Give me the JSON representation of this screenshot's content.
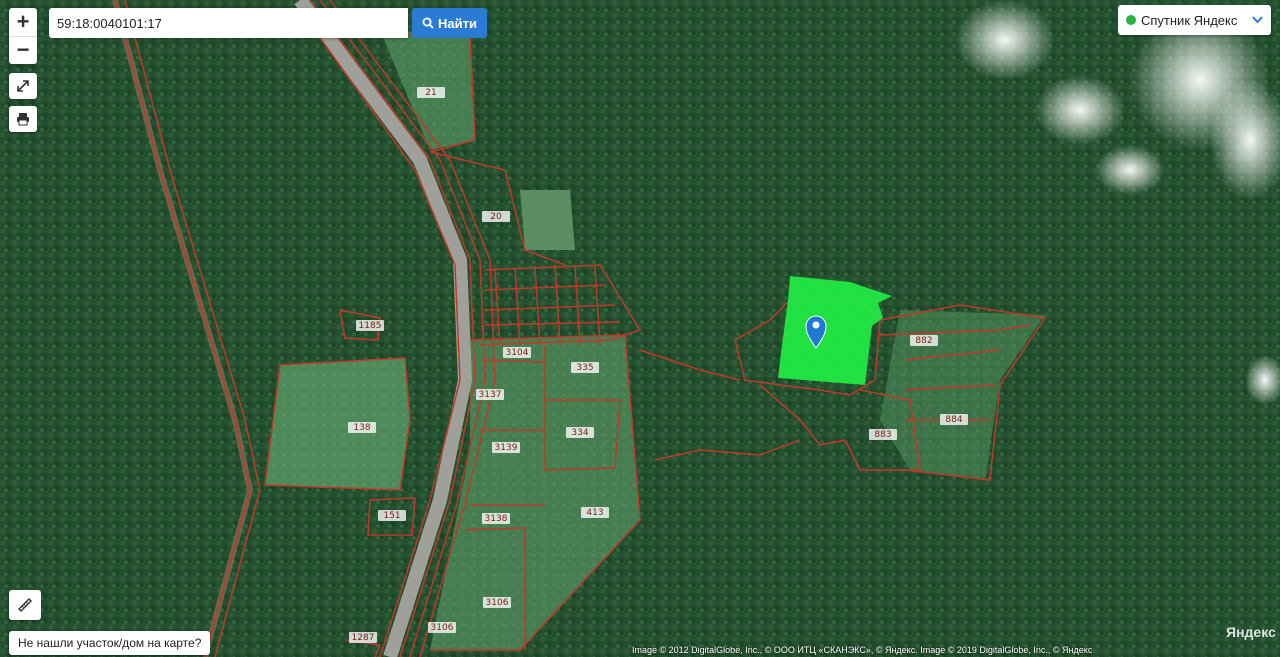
{
  "search": {
    "value": "59:18:0040101:17",
    "button_label": "Найти"
  },
  "zoom": {
    "in_label": "+",
    "out_label": "−"
  },
  "layer": {
    "label": "Спутник Яндекс",
    "active_color": "#2bb140"
  },
  "not_found_label": "Не нашли участок/дом на карте?",
  "attribution": "Image © 2012 DigitalGlobe, Inc., © ООО ИТЦ «СКАНЭКС», © Яндекс. Image © 2019 DigitalGlobe, Inc., © Яндекс",
  "logo": "Яндекс",
  "parcel_labels": [
    "21",
    "20",
    "1185",
    "3104",
    "335",
    "3137",
    "138",
    "334",
    "3139",
    "151",
    "3138",
    "413",
    "3106",
    "3106",
    "882",
    "883",
    "884",
    "1287"
  ],
  "colors": {
    "boundary": "#c0392b",
    "selected_parcel": "#22ee44",
    "marker": "#1f78d1",
    "accent": "#2a7bd3"
  },
  "icons": {
    "fullscreen": "expand-icon",
    "print": "printer-icon",
    "ruler": "ruler-icon",
    "search": "search-icon",
    "marker": "map-pin-icon"
  }
}
